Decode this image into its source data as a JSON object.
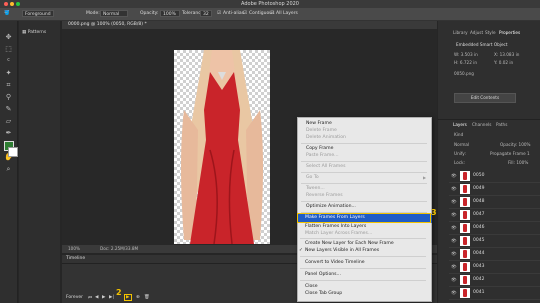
{
  "window": {
    "title": "Adobe Photoshop 2020"
  },
  "options_bar": {
    "preset": "Foreground",
    "mode_label": "Mode:",
    "mode_value": "Normal",
    "opacity_label": "Opacity:",
    "opacity_value": "100%",
    "tolerance_label": "Tolerance:",
    "tolerance_value": "32",
    "antialias_label": "Anti-alias",
    "contiguous_label": "Contiguous",
    "all_layers_label": "All Layers"
  },
  "patterns_panel": {
    "label": "Patterns"
  },
  "document": {
    "tab_title": "0000.png @ 100% (0050, RGB/8) *",
    "zoom": "100%",
    "doc_info": "Doc: 2.25M/33.8M"
  },
  "timeline": {
    "tab_label": "Timeline",
    "forever_label": "Forever",
    "callout_number": "2"
  },
  "right_panel": {
    "tabs_top": [
      "Library",
      "Adjust",
      "Style",
      "Properties"
    ],
    "embedded_label": "Embedded Smart Object",
    "w_label": "W: 3.503 in",
    "x_label": "X: 13.083 in",
    "h_label": "H: 6.722 in",
    "y_label": "Y: 0.02 in",
    "filename": "0050.png",
    "edit_button": "Edit Contents",
    "layers_tabs": [
      "Layers",
      "Channels",
      "Paths"
    ],
    "kind_label": "Kind",
    "blend_mode": "Normal",
    "opacity_label": "Opacity: 100%",
    "unify_label": "Unify:",
    "propagate_label": "Propagate Frame 1",
    "lock_label": "Lock:",
    "fill_label": "Fill: 100%",
    "layers": [
      "0050",
      "0049",
      "0048",
      "0047",
      "0046",
      "0045",
      "0044",
      "0043",
      "0042",
      "0041"
    ]
  },
  "context_menu": {
    "items": [
      {
        "label": "New Frame",
        "disabled": false
      },
      {
        "label": "Delete Frame",
        "disabled": true
      },
      {
        "label": "Delete Animation",
        "disabled": true
      },
      {
        "label": "Copy Frame",
        "disabled": false
      },
      {
        "label": "Paste Frame...",
        "disabled": true
      },
      {
        "label": "Select All Frames",
        "disabled": true
      },
      {
        "label": "Go To",
        "disabled": true
      },
      {
        "label": "Tween...",
        "disabled": true
      },
      {
        "label": "Reverse Frames",
        "disabled": true
      },
      {
        "label": "Optimize Animation...",
        "disabled": false
      },
      {
        "label": "Make Frames From Layers",
        "disabled": false,
        "highlighted": true
      },
      {
        "label": "Flatten Frames Into Layers",
        "disabled": false
      },
      {
        "label": "Match Layer Across Frames...",
        "disabled": true
      },
      {
        "label": "Create New Layer for Each New Frame",
        "disabled": false
      },
      {
        "label": "New Layers Visible in All Frames",
        "disabled": false,
        "checked": true
      },
      {
        "label": "Convert to Video Timeline",
        "disabled": false
      },
      {
        "label": "Panel Options...",
        "disabled": false
      },
      {
        "label": "Close",
        "disabled": false
      },
      {
        "label": "Close Tab Group",
        "disabled": false
      }
    ],
    "go_to_arrow": "▶",
    "checkmark": "✓",
    "callout_number": "3"
  },
  "colors": {
    "highlight": "#1f5cc6",
    "callout": "#f3c300",
    "dress_red": "#c9242a"
  },
  "icons": [
    "close-dot",
    "minimize-dot",
    "zoom-dot",
    "move-tool-icon",
    "marquee-tool-icon",
    "lasso-tool-icon",
    "crop-tool-icon",
    "brush-tool-icon",
    "type-tool-icon",
    "hand-tool-icon",
    "zoom-tool-icon",
    "eye-icon",
    "play-icon"
  ]
}
